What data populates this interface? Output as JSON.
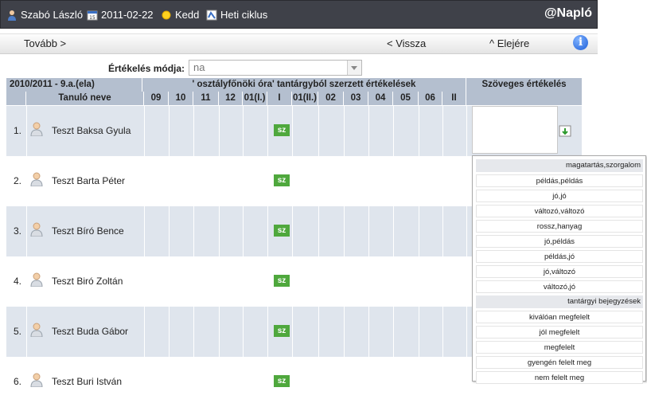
{
  "topbar": {
    "user": "Szabó László",
    "date": "2011-02-22",
    "day": "Kedd",
    "cycle": "Heti ciklus",
    "brand": "@Napló"
  },
  "nav": {
    "forward": "Tovább >",
    "back": "< Vissza",
    "top": "^ Elejére"
  },
  "eval": {
    "label": "Értékelés módja:",
    "value": "na"
  },
  "table": {
    "class_label": "2010/2011 - 9.a.(ela)",
    "subject_header": "' osztályfőnöki óra' tantárgyból szerzett értékelések",
    "text_header": "Szöveges értékelés",
    "name_header": "Tanuló neve",
    "months": [
      "09",
      "10",
      "11",
      "12",
      "01(I.)",
      "I",
      "01(II.)",
      "02",
      "03",
      "04",
      "05",
      "06",
      "II"
    ],
    "sz_label": "sz",
    "students": [
      {
        "num": "1.",
        "name": "Teszt Baksa Gyula"
      },
      {
        "num": "2.",
        "name": "Teszt Barta Péter"
      },
      {
        "num": "3.",
        "name": "Teszt Bíró Bence"
      },
      {
        "num": "4.",
        "name": "Teszt Biró Zoltán"
      },
      {
        "num": "5.",
        "name": "Teszt Buda Gábor"
      },
      {
        "num": "6.",
        "name": "Teszt Buri István"
      }
    ]
  },
  "popup": {
    "header1": "magatartás,szorgalom",
    "items1": [
      "példás,példás",
      "jó,jó",
      "változó,változó",
      "rossz,hanyag",
      "jó,példás",
      "példás,jó",
      "jó,változó",
      "változó,jó"
    ],
    "header2": "tantárgyi bejegyzések",
    "items2": [
      "kiválóan megfelelt",
      "jól megfelelt",
      "megfelelt",
      "gyengén felelt meg",
      "nem felelt meg"
    ]
  },
  "icons": {
    "user": "user-icon",
    "calendar": "calendar-icon",
    "sun": "sun-icon",
    "cycle": "cycle-icon",
    "info": "info-icon",
    "avatar": "student-avatar-icon",
    "insert": "insert-text-icon"
  }
}
